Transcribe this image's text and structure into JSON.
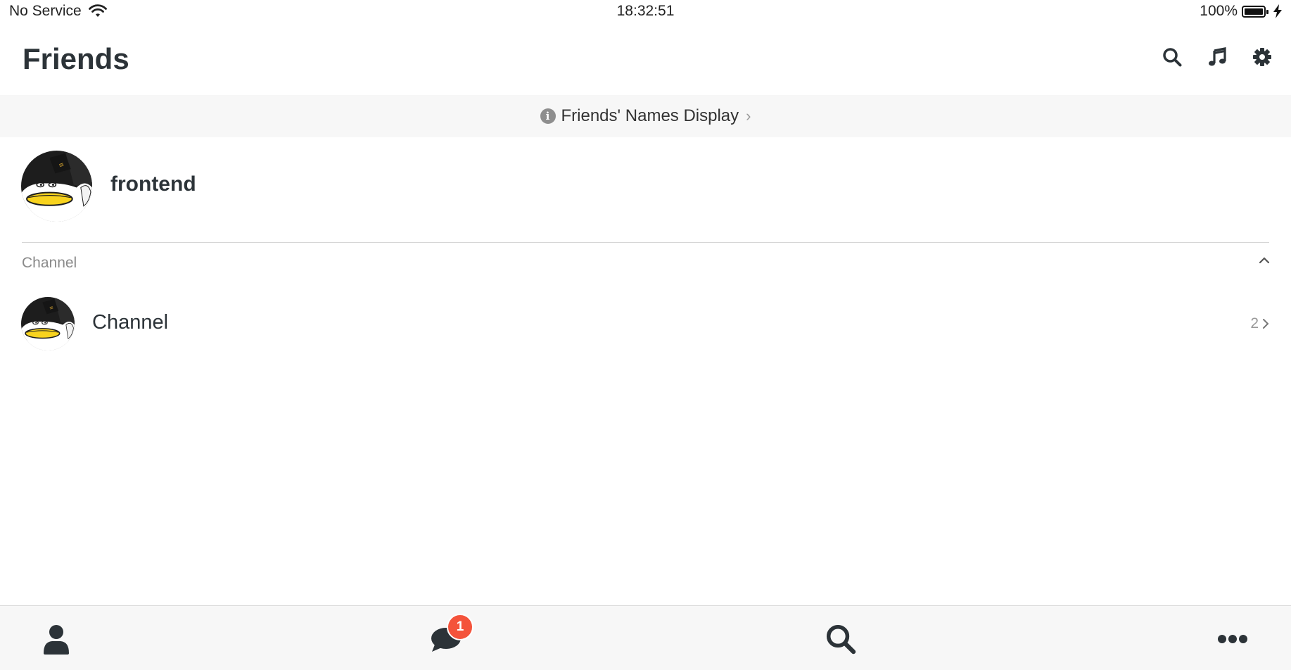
{
  "status": {
    "carrier": "No Service",
    "time": "18:32:51",
    "battery": "100%"
  },
  "header": {
    "title": "Friends",
    "icons": [
      "search-icon",
      "music-note-icon",
      "gear-icon"
    ]
  },
  "banner": {
    "label": "Friends' Names Display"
  },
  "profile": {
    "name": "frontend"
  },
  "section": {
    "label": "Channel",
    "expanded": true
  },
  "channel": {
    "name": "Channel",
    "count": "2"
  },
  "tabbar": {
    "tabs": [
      "contacts-icon",
      "chat-icon",
      "search-icon",
      "more-icon"
    ],
    "chat_badge": "1"
  },
  "colors": {
    "badge": "#f4533b",
    "text": "#2c3338",
    "banner_bg": "#f7f7f7"
  }
}
